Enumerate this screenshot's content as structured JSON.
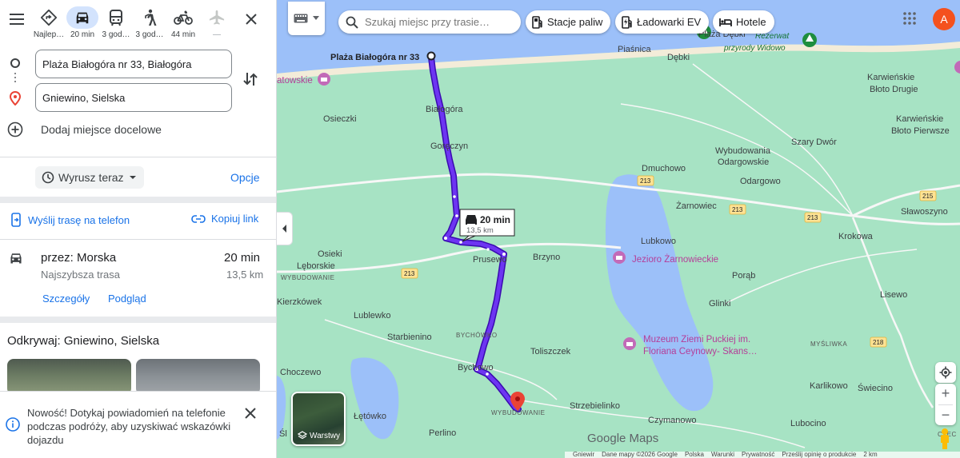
{
  "travel_modes": [
    {
      "label": "Najlep…",
      "icon": "best-route-icon"
    },
    {
      "label": "20 min",
      "icon": "car-icon"
    },
    {
      "label": "3 god…",
      "icon": "transit-icon"
    },
    {
      "label": "3 god…",
      "icon": "walk-icon"
    },
    {
      "label": "44 min",
      "icon": "bike-icon"
    },
    {
      "label": "—",
      "icon": "flight-icon"
    }
  ],
  "waypoints": {
    "origin": "Plaża Białogóra nr 33, Białogóra",
    "destination": "Gniewino, Sielska",
    "add_destination": "Dodaj miejsce docelowe"
  },
  "depart": {
    "label": "Wyrusz teraz",
    "options": "Opcje"
  },
  "share": {
    "send_to_phone": "Wyślij trasę na telefon",
    "copy_link": "Kopiuj link"
  },
  "route": {
    "title": "przez: Morska",
    "subtitle": "Najszybsza trasa",
    "time": "20 min",
    "distance": "13,5 km",
    "details": "Szczegóły",
    "preview": "Podgląd"
  },
  "explore": {
    "title": "Odkrywaj: Gniewino, Sielska"
  },
  "notice": {
    "text": "Nowość! Dotykaj powiadomień na telefonie podczas podróży, aby uzyskiwać wskazówki dojazdu"
  },
  "map": {
    "search_placeholder": "Szukaj miejsc przy trasie…",
    "chips": [
      "Stacje paliw",
      "Ładowarki EV",
      "Hotele"
    ],
    "avatar_letter": "A",
    "layers_label": "Warstwy",
    "callout": {
      "time": "20 min",
      "distance": "13,5 km"
    },
    "origin_label": "Plaża Białogóra nr 33",
    "brand": "Google Maps",
    "footer": [
      "Gniewir",
      "Dane mapy ©2026 Google",
      "Polska",
      "Warunki",
      "Prywatność",
      "Prześlij opinię o produkcie",
      "2 km"
    ],
    "places": {
      "plaza_debki": "Plaża Dębki",
      "rezerwat": "Rezerwat",
      "przyrody_widowo": "przyrody Widowo",
      "piasnica": "Piaśnica",
      "debki": "Dębki",
      "karwienskie_blota_drugie_1": "Karwieńskie",
      "karwienskie_blota_drugie_2": "Błoto Drugie",
      "karwienskie_blota_pierwsze_1": "Karwieńskie",
      "karwienskie_blota_pierwsze_2": "Błoto Pierwsze",
      "atowskie": "atowskie",
      "bialogora": "Białogóra",
      "osieczki": "Osieczki",
      "goreczyn": "Goręczyn",
      "szary_dwor": "Szary Dwór",
      "wybudowania_1": "Wybudowania",
      "wybudowania_2": "Odargowskie",
      "dmuchowo": "Dmuchowo",
      "odargowo": "Odargowo",
      "zarnowiec": "Żarnowiec",
      "slawoszyno": "Sławoszyno",
      "krokowa": "Krokowa",
      "lubkowo": "Lubkowo",
      "osieki_1": "Osieki",
      "osieki_2": "Lęborskie",
      "prusewo": "Prusewo",
      "brzyno": "Brzyno",
      "jezioro": "Jezioro Żarnowieckie",
      "porab": "Porąb",
      "wybudowanie_small": "WYBUDOWANIE",
      "kierzkowek": "Kierzkówek",
      "lublewko": "Lublewko",
      "glinki": "Glinki",
      "lisewo": "Lisewo",
      "starbienino": "Starbienino",
      "bychowko": "BYCHÓWKO",
      "muzeum_1": "Muzeum Ziemi Puckiej im.",
      "muzeum_2": "Floriana Ceynowy- Skans…",
      "toliszczek": "Toliszczek",
      "mysliwka": "MYŚLIWKA",
      "choczewo": "Choczewo",
      "bychowo": "Bychowo",
      "karlikowo": "Karlikowo",
      "swiecino": "Świecino",
      "strzebielinko": "Strzebielinko",
      "letowko": "Łętówko",
      "wybudowanie_dest": "WYBUDOWANIE",
      "czymanowo": "Czymanowo",
      "lubocino": "Lubocino",
      "perlino": "Perlino",
      "sl": "Śl",
      "czec": "CZEC"
    },
    "roads": [
      "213",
      "213",
      "213",
      "215",
      "213",
      "218"
    ]
  },
  "colors": {
    "route": "#5a1ce8",
    "land": "#a7e3c4",
    "water": "#9cc0f9",
    "accent": "#1a73e8"
  }
}
